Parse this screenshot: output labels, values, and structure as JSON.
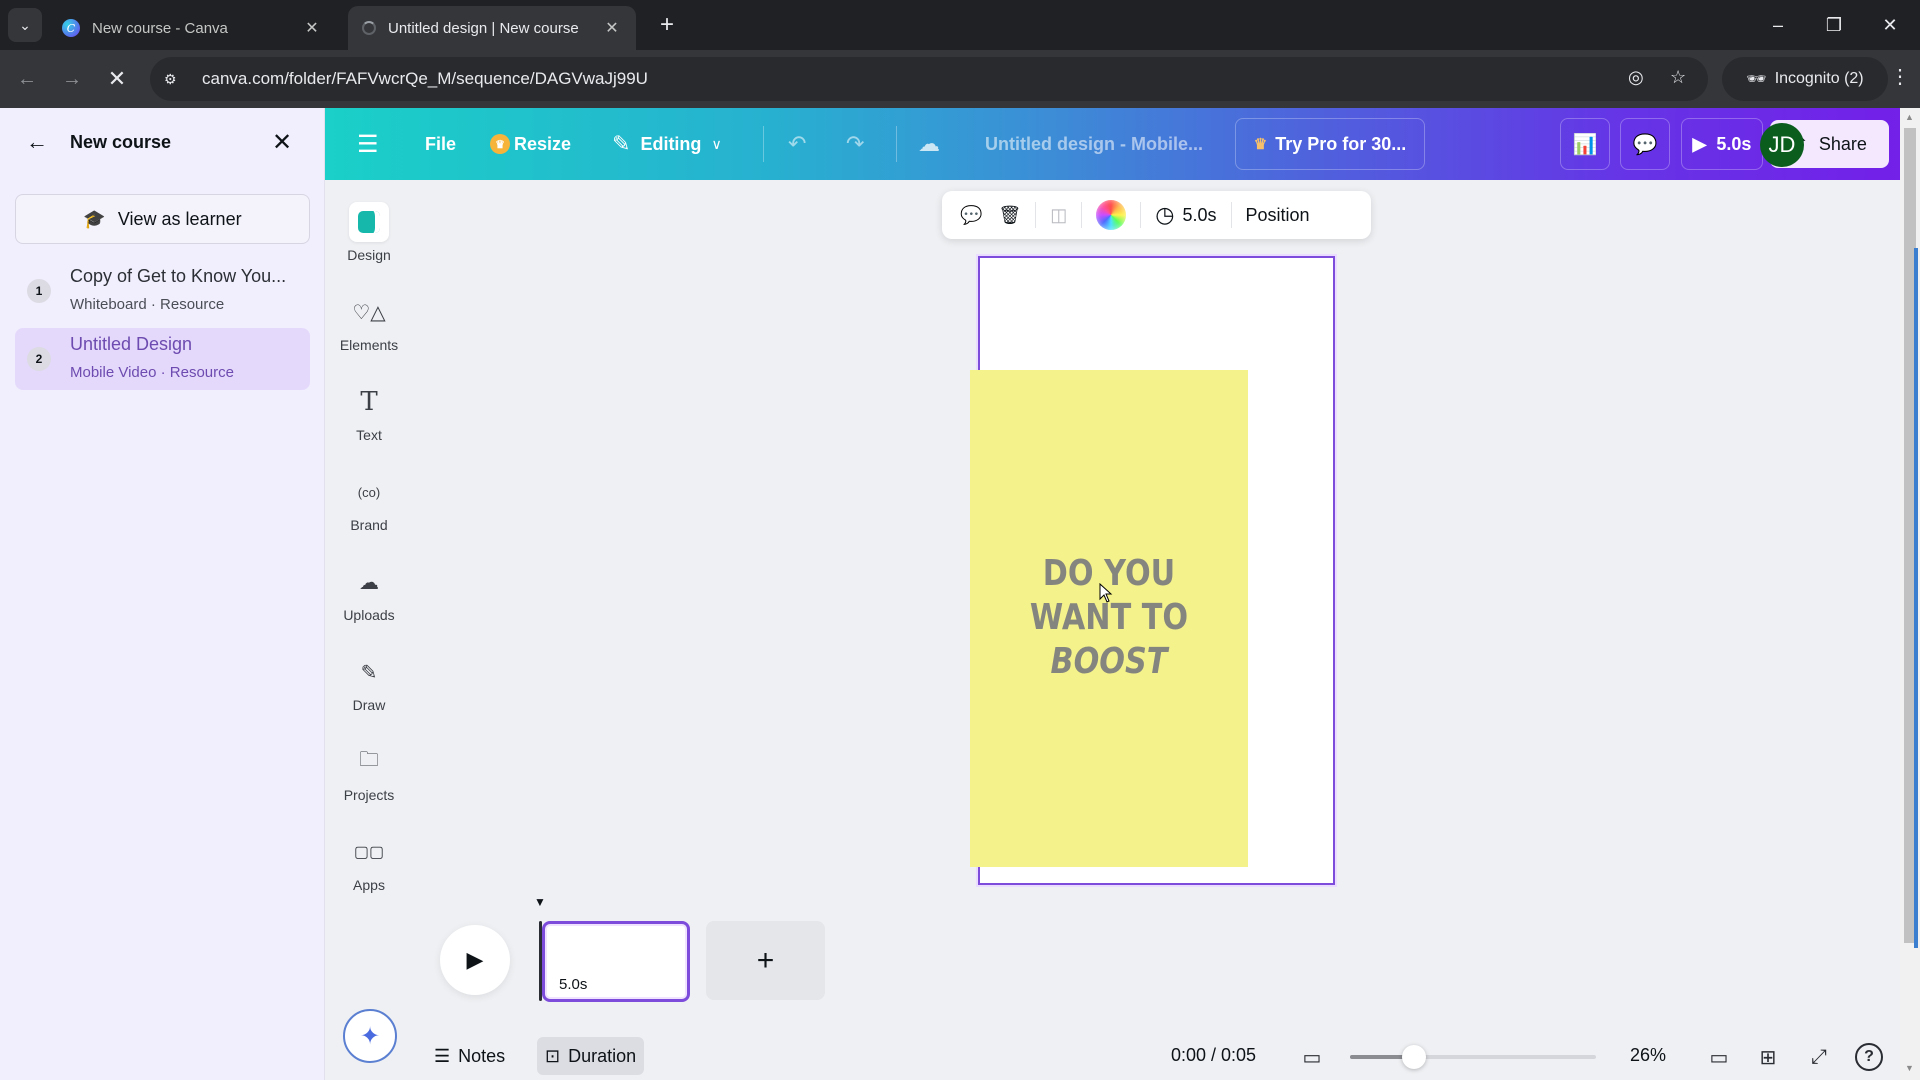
{
  "browser": {
    "tabs": [
      {
        "title": "New course - Canva",
        "favicon": "canva-logo-icon",
        "active": false
      },
      {
        "title": "Untitled design | New course",
        "favicon": "loading-icon",
        "active": true
      }
    ],
    "url": "canva.com/folder/FAFVwcrQe_M/sequence/DAGVwaJj99U",
    "profile_label": "Incognito (2)",
    "window_controls": {
      "minimize": "–",
      "restore": "❐",
      "close": "✕"
    }
  },
  "course_panel": {
    "title": "New course",
    "view_as_learner_label": "View as learner",
    "items": [
      {
        "number": "1",
        "name": "Copy of Get to Know You...",
        "type": "Whiteboard · Resource",
        "selected": false
      },
      {
        "number": "2",
        "name": "Untitled Design",
        "type": "Mobile Video · Resource",
        "selected": true
      }
    ]
  },
  "header": {
    "file_label": "File",
    "resize_label": "Resize",
    "editing_label": "Editing",
    "design_title": "Untitled design - Mobile...",
    "try_pro_label": "Try Pro for 30...",
    "avatar_initials": "JD",
    "play_duration": "5.0s",
    "share_label": "Share"
  },
  "rail": {
    "items": [
      {
        "label": "Design",
        "icon": "design-icon",
        "active": true
      },
      {
        "label": "Elements",
        "icon": "elements-icon",
        "active": false
      },
      {
        "label": "Text",
        "icon": "text-icon",
        "active": false
      },
      {
        "label": "Brand",
        "icon": "brand-icon",
        "active": false
      },
      {
        "label": "Uploads",
        "icon": "uploads-icon",
        "active": false
      },
      {
        "label": "Draw",
        "icon": "draw-icon",
        "active": false
      },
      {
        "label": "Projects",
        "icon": "projects-icon",
        "active": false
      },
      {
        "label": "Apps",
        "icon": "apps-icon",
        "active": false
      }
    ]
  },
  "context_toolbar": {
    "duration": "5.0s",
    "position_label": "Position"
  },
  "canvas": {
    "headline_lines": [
      "DO YOU",
      "WANT TO",
      "BOOST"
    ],
    "box_color": "#f4f28b",
    "text_color": "#85857f",
    "selection_color": "#7d4cdb"
  },
  "timeline": {
    "clip_duration": "5.0s"
  },
  "footer": {
    "notes_label": "Notes",
    "duration_label": "Duration",
    "time_readout": "0:00 / 0:05",
    "zoom_percent": "26%",
    "zoom_slider_fraction": 0.26
  },
  "colors": {
    "header_gradient_start": "#1ad0c8",
    "header_gradient_end": "#7320e8",
    "accent_purple": "#7d4cdb",
    "avatar_bg": "#0b5d1e"
  }
}
